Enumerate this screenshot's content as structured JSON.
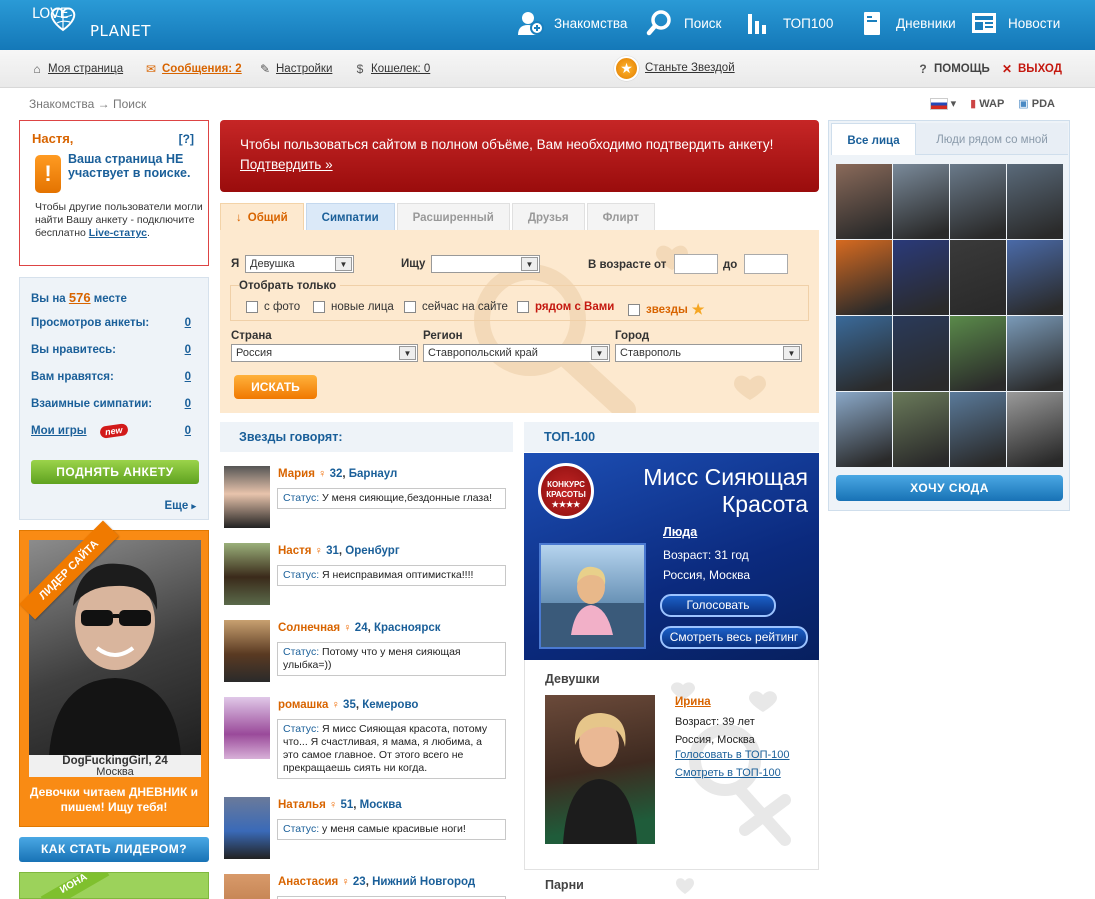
{
  "header": {
    "logo_love": "LOVE",
    "logo_planet": "PLANET",
    "nav": [
      {
        "label": "Знакомства",
        "icon": "people-icon"
      },
      {
        "label": "Поиск",
        "icon": "magnifier-icon"
      },
      {
        "label": "ТОП100",
        "icon": "bar-chart-icon"
      },
      {
        "label": "Дневники",
        "icon": "notebook-icon"
      },
      {
        "label": "Новости",
        "icon": "newspaper-icon"
      }
    ]
  },
  "subbar": {
    "my_page": "Моя страница",
    "messages": "Сообщения: 2",
    "settings": "Настройки",
    "wallet": "Кошелек: 0",
    "become_star": "Станьте Звездой",
    "help": "ПОМОЩЬ",
    "exit": "ВЫХОД"
  },
  "breadcrumb": {
    "root": "Знакомства",
    "sep": "→",
    "current": "Поиск"
  },
  "rightlinks": {
    "wap": "WAP",
    "pda": "PDA"
  },
  "notice": {
    "name": "Настя,",
    "help": "[?]",
    "big": "Ваша страница НЕ участвует в поиске.",
    "small_pre": "Чтобы другие пользователи могли найти Вашу анкету - подключите бесплатно",
    "small_link": "Live-статус",
    "small_post": "."
  },
  "stats": {
    "place_pre": "Вы на",
    "place_val": "576",
    "place_post": "месте",
    "rows": [
      {
        "label": "Просмотров анкеты:",
        "value": "0"
      },
      {
        "label": "Вы нравитесь:",
        "value": "0"
      },
      {
        "label": "Вам нравятся:",
        "value": "0"
      },
      {
        "label": "Взаимные симпатии:",
        "value": "0"
      },
      {
        "label": "Мои игры",
        "value": "0"
      }
    ],
    "new_badge": "new",
    "raise_btn": "ПОДНЯТЬ АНКЕТУ",
    "more": "Еще"
  },
  "leader": {
    "ribbon": "ЛИДЕР САЙТА",
    "name": "DogFuckingGirl, 24",
    "city": "Москва",
    "message": "Девочки читаем ДНЕВНИК и пишем! Ищу тебя!",
    "how_btn": "КАК СТАТЬ ЛИДЕРОМ?",
    "ribbon2": "ИОНА"
  },
  "banner": {
    "text": "Чтобы пользоваться сайтом в полном объёме, Вам необходимо подтвердить анкету!",
    "link": "Подтвердить »"
  },
  "tabs": [
    "Общий",
    "Симпатии",
    "Расширенный",
    "Друзья",
    "Флирт"
  ],
  "search": {
    "i_label": "Я",
    "i_value": "Девушка",
    "seek_label": "Ищу",
    "seek_value": "",
    "age_label": "В возрасте от",
    "age_to": "до",
    "show_only": "Отобрать только",
    "checks": [
      "с фото",
      "новые лица",
      "сейчас на сайте",
      "рядом с Вами",
      "звезды"
    ],
    "country_label": "Страна",
    "country_value": "Россия",
    "region_label": "Регион",
    "region_value": "Ставропольский край",
    "city_label": "Город",
    "city_value": "Ставрополь",
    "search_btn": "ИСКАТЬ"
  },
  "stars_say": {
    "title": "Звезды говорят:",
    "status_label": "Статус:",
    "items": [
      {
        "name": "Мария",
        "age": "32",
        "city": "Барнаул",
        "status": "У меня сияющие,бездонные глаза!"
      },
      {
        "name": "Настя",
        "age": "31",
        "city": "Оренбург",
        "status": "Я неисправимая оптимистка!!!!"
      },
      {
        "name": "Солнечная",
        "age": "24",
        "city": "Красноярск",
        "status": "Потому что у меня сияющая улыбка=))"
      },
      {
        "name": "ромашка",
        "age": "35",
        "city": "Кемерово",
        "status": "Я мисс Сияющая красота, потому что... Я счастливая, я мама, я любима, а это самое главное. От этого всего не прекращаешь сиять ни когда."
      },
      {
        "name": "Наталья",
        "age": "51",
        "city": "Москва",
        "status": "у меня самые красивые ноги!"
      },
      {
        "name": "Анастасия",
        "age": "23",
        "city": "Нижний Новгород",
        "status": ""
      }
    ]
  },
  "top100": {
    "title": "ТОП-100",
    "badge_text": "КОНКУРС КРАСОТЫ",
    "contest": "Мисс Сияющая Красота",
    "winner_name": "Люда",
    "winner_age": "Возраст: 31 год",
    "winner_loc": "Россия, Москва",
    "vote_btn": "Голосовать",
    "rating_btn": "Смотреть весь рейтинг"
  },
  "girls": {
    "title": "Девушки",
    "name": "Ирина",
    "age": "Возраст: 39 лет",
    "loc": "Россия, Москва",
    "vote_link": "Голосовать в ТОП-100",
    "view_link": "Смотреть в ТОП-100",
    "boys_title": "Парни"
  },
  "right": {
    "tab_all": "Все лица",
    "tab_near": "Люди рядом со мной",
    "want_btn": "ХОЧУ СЮДА",
    "photos": [
      "#8a6a5a",
      "#7a8a9a",
      "#6a7a8a",
      "#5a6a7a",
      "#d66a20",
      "#2a3a7a",
      "#3a3a3a",
      "#4a6aa8",
      "#3a6a9a",
      "#2a3a5a",
      "#5a8a4a",
      "#7a9ab8",
      "#8aa8c8",
      "#6a7a5a",
      "#5a7a9a",
      "#9a9a9a"
    ]
  }
}
